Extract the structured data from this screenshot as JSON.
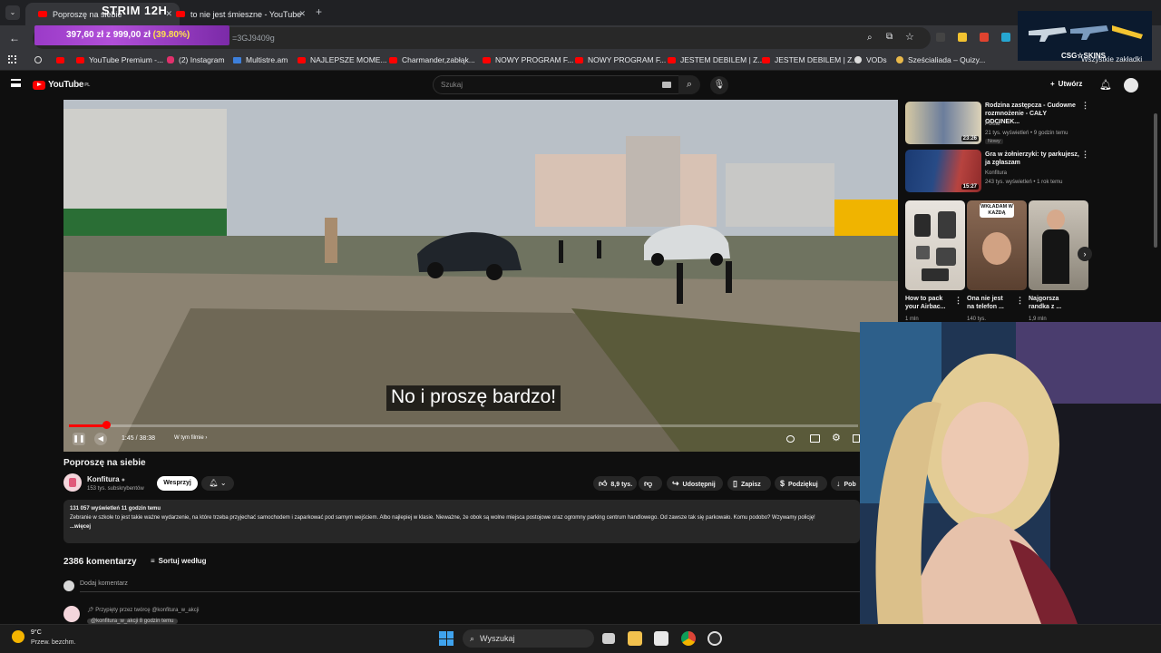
{
  "browser": {
    "tabs": [
      {
        "label": "Poproszę na siebie",
        "active": true
      },
      {
        "label": "to nie jest śmieszne - YouTube",
        "active": false
      }
    ],
    "new_tab": "+",
    "url_fragment": "=3GJ9409g",
    "bookmarks": [
      {
        "label": "YouTube Premium -...",
        "icon": "youtube-icon"
      },
      {
        "label": "(2) Instagram",
        "icon": "instagram-icon"
      },
      {
        "label": "Multistre.am",
        "icon": "multistream-icon"
      },
      {
        "label": "NAJLEPSZE MOME...",
        "icon": "youtube-icon"
      },
      {
        "label": "Charmander,zabłąk...",
        "icon": "youtube-icon"
      },
      {
        "label": "NOWY PROGRAM F...",
        "icon": "youtube-icon"
      },
      {
        "label": "NOWY PROGRAM F...",
        "icon": "youtube-icon"
      },
      {
        "label": "JESTEM DEBILEM | Z...",
        "icon": "youtube-icon"
      },
      {
        "label": "JESTEM DEBILEM | Z...",
        "icon": "youtube-icon"
      },
      {
        "label": "VODs",
        "icon": "globe-icon"
      },
      {
        "label": "Sześcialiada – Quizy...",
        "icon": "quiz-icon"
      }
    ],
    "all_bookmarks": "Wszystkie zakładki"
  },
  "overlay": {
    "stream_title": "STRIM 12H",
    "goal_amount": "397,60 zł z 999,00 zł",
    "goal_percent": "(39.80%)",
    "goal_fraction": 0.398,
    "sponsor_label": "CSG☆SKINS"
  },
  "youtube": {
    "logo": "YouTube",
    "logo_region": "PL",
    "search_placeholder": "Szukaj",
    "create_label": "Utwórz"
  },
  "player": {
    "subtitle": "No i proszę bardzo!",
    "time": "1:45 / 38:38",
    "chapter": "W tym filmie",
    "progress_fraction": 0.045
  },
  "video": {
    "title": "Poproszę na siebie",
    "channel": "Konfitura",
    "subscribers": "153 tys. subskrybentów",
    "support_label": "Wesprzyj",
    "likes": "8,9 tys.",
    "share": "Udostępnij",
    "save": "Zapisz",
    "thanks": "Podziękuj",
    "download": "Pob",
    "desc_meta": "131 057 wyświetleń  11 godzin temu",
    "desc_text": "Zebranie w szkole to jest takie ważne wydarzenie, na które trzeba przyjechać samochodem i zaparkować pod samym wejściem. Albo najlepiej w klasie. Nieważne, że obok są wolne miejsca postojowe oraz ogromny parking centrum handlowego. Od zawsze tak się parkowało. Komu podobo? Wzywamy policję!",
    "desc_more": "...więcej",
    "comments_count": "2386 komentarzy",
    "sort_label": "Sortuj według",
    "add_comment": "Dodaj komentarz",
    "pinned_by": "Przypięty przez twórcę @konfitura_w_akcji",
    "comment_handle": "@konfitura_w_akcji",
    "comment_time": "8 godzin temu"
  },
  "recommendations": [
    {
      "title_line1": "Rodzina zastępcza - Cudowne",
      "title_line2": "rozmnożenie - CAŁY ODCINEK...",
      "channel": "Polsat",
      "meta": "21 tys. wyświetleń • 9 godzin temu",
      "badge": "Nowy",
      "duration": "23:26"
    },
    {
      "title_line1": "Gra w żołnierzyki: ty parkujesz,",
      "title_line2": "ja zgłaszam",
      "channel": "Konfitura",
      "meta": "243 tys. wyświetleń • 1 rok temu",
      "duration": "15:27"
    }
  ],
  "shorts": [
    {
      "title_line1": "How to pack",
      "title_line2": "your Airbac...",
      "views": "1 mln"
    },
    {
      "title_line1": "Ona nie jest",
      "title_line2": "na telefon ...",
      "views": "140 tys.",
      "thumb_text": "WKŁADAM W KAŻDĄ"
    },
    {
      "title_line1": "Najgorsza",
      "title_line2": "randka z ...",
      "views": "1,9 mln"
    }
  ],
  "taskbar": {
    "temperature": "9°C",
    "weather": "Przew. bezchm.",
    "search_label": "Wyszukaj"
  },
  "colors": {
    "yt_red": "#ff0000",
    "bg": "#0f0f0f",
    "overlay_purple": "#9b3bc8",
    "goal_yellow": "#ffe14d"
  }
}
